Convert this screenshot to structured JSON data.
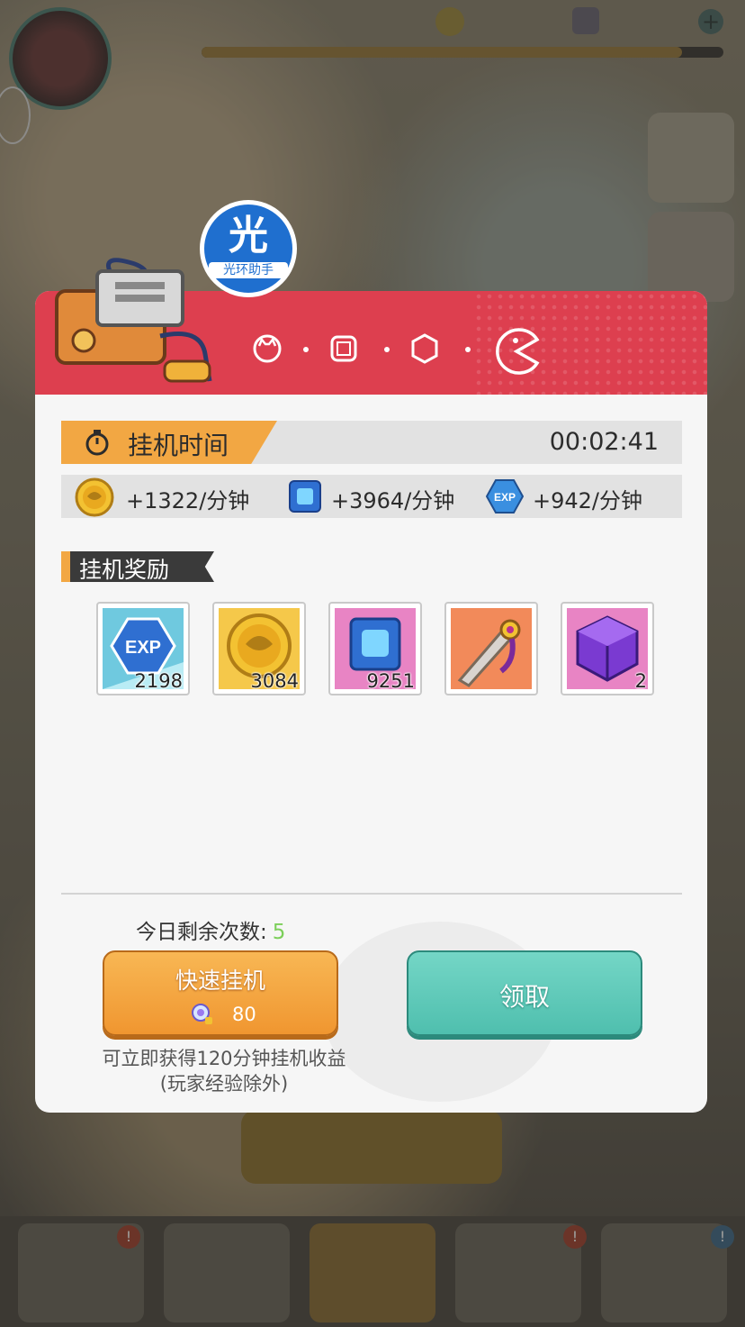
{
  "watermark": {
    "big": "光",
    "small": "光环助手"
  },
  "dialog": {
    "timer": {
      "label": "挂机时间",
      "value": "00:02:41"
    },
    "rates": [
      {
        "icon": "coin-icon",
        "text": "+1322/分钟"
      },
      {
        "icon": "chip-icon",
        "text": "+3964/分钟"
      },
      {
        "icon": "exp-icon",
        "text": "+942/分钟"
      }
    ],
    "rewards_title": "挂机奖励",
    "rewards": [
      {
        "icon": "exp-icon",
        "count": "2198"
      },
      {
        "icon": "coin-icon",
        "count": "3084"
      },
      {
        "icon": "chip-icon",
        "count": "9251"
      },
      {
        "icon": "sword-icon",
        "count": ""
      },
      {
        "icon": "cube-icon",
        "count": "2"
      }
    ],
    "remaining_label": "今日剩余次数:",
    "remaining_count": "5",
    "fast_button": {
      "label": "快速挂机",
      "cost": "80"
    },
    "claim_button": {
      "label": "领取"
    },
    "hint_line1": "可立即获得120分钟挂机收益",
    "hint_line2": "(玩家经验除外)"
  },
  "colors": {
    "header": "#dd3f4f",
    "accent_orange": "#f2a743",
    "claim": "#4fbfae",
    "remaining": "#7ccf5a"
  }
}
